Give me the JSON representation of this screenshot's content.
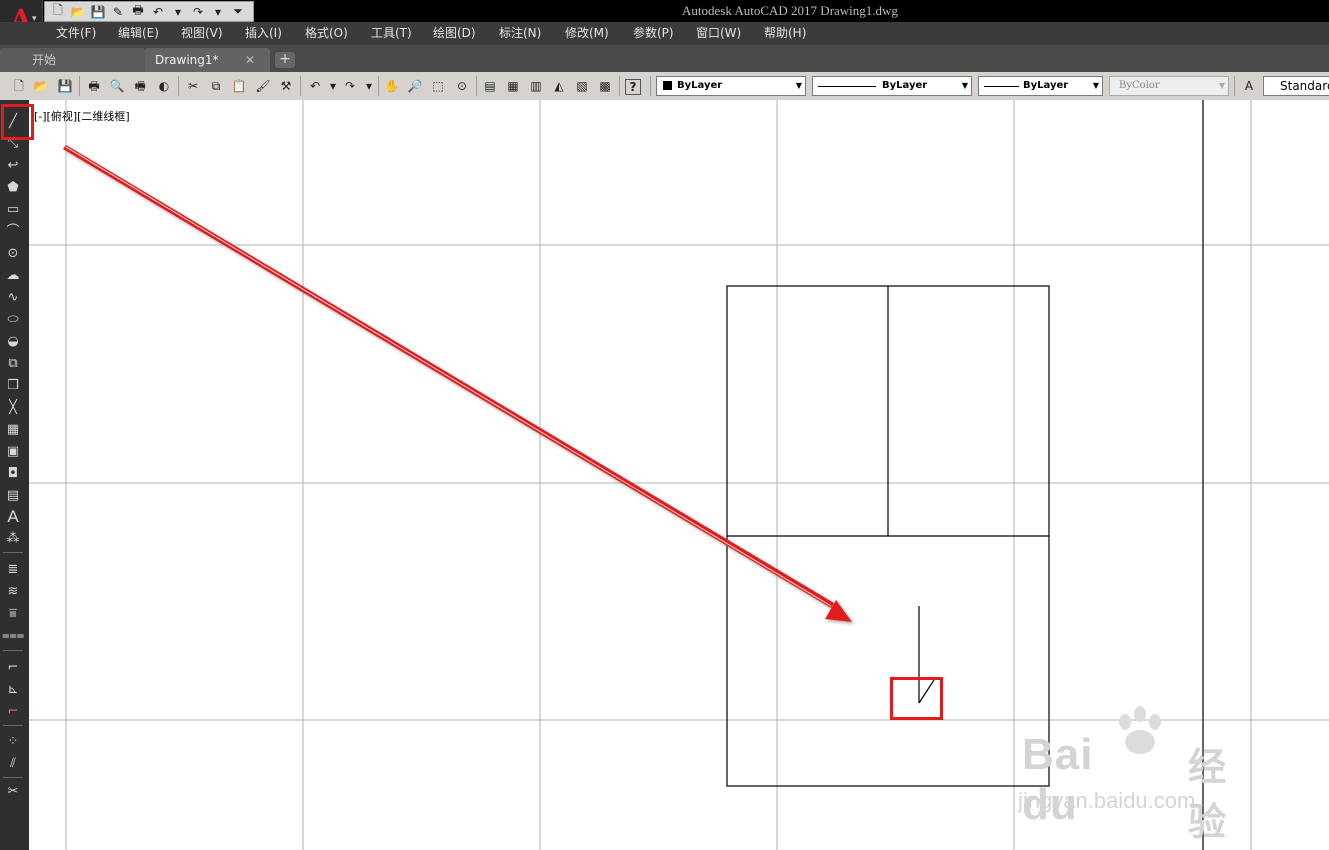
{
  "window": {
    "title": "Autodesk AutoCAD 2017    Drawing1.dwg"
  },
  "app": {
    "logo_letter": "A"
  },
  "quick_access": [
    "new-icon",
    "open-icon",
    "save-icon",
    "saveas-icon",
    "plot-icon",
    "undo-icon",
    "redo-icon",
    "customize-icon"
  ],
  "menu": [
    {
      "label": "文件(F)"
    },
    {
      "label": "编辑(E)"
    },
    {
      "label": "视图(V)"
    },
    {
      "label": "插入(I)"
    },
    {
      "label": "格式(O)"
    },
    {
      "label": "工具(T)"
    },
    {
      "label": "绘图(D)"
    },
    {
      "label": "标注(N)"
    },
    {
      "label": "修改(M)"
    },
    {
      "label": "参数(P)"
    },
    {
      "label": "窗口(W)"
    },
    {
      "label": "帮助(H)"
    }
  ],
  "tabs": {
    "start": "开始",
    "drawing": "Drawing1*",
    "close": "✕",
    "add": "+"
  },
  "properties": {
    "color": "ByLayer",
    "linetype": "ByLayer",
    "lineweight": "ByLayer",
    "plotstyle": "ByColor",
    "textstyle": "Standard"
  },
  "viewport": {
    "label": "[-][俯视][二维线框]"
  },
  "watermark": {
    "brand": "Bai  du",
    "cn": "经验",
    "url": "jingyan.baidu.com"
  },
  "colors": {
    "highlight": "#e21c1c",
    "menubar": "#3b3b3b",
    "toolbar": "#d6d3ce",
    "canvas": "#ffffff"
  }
}
